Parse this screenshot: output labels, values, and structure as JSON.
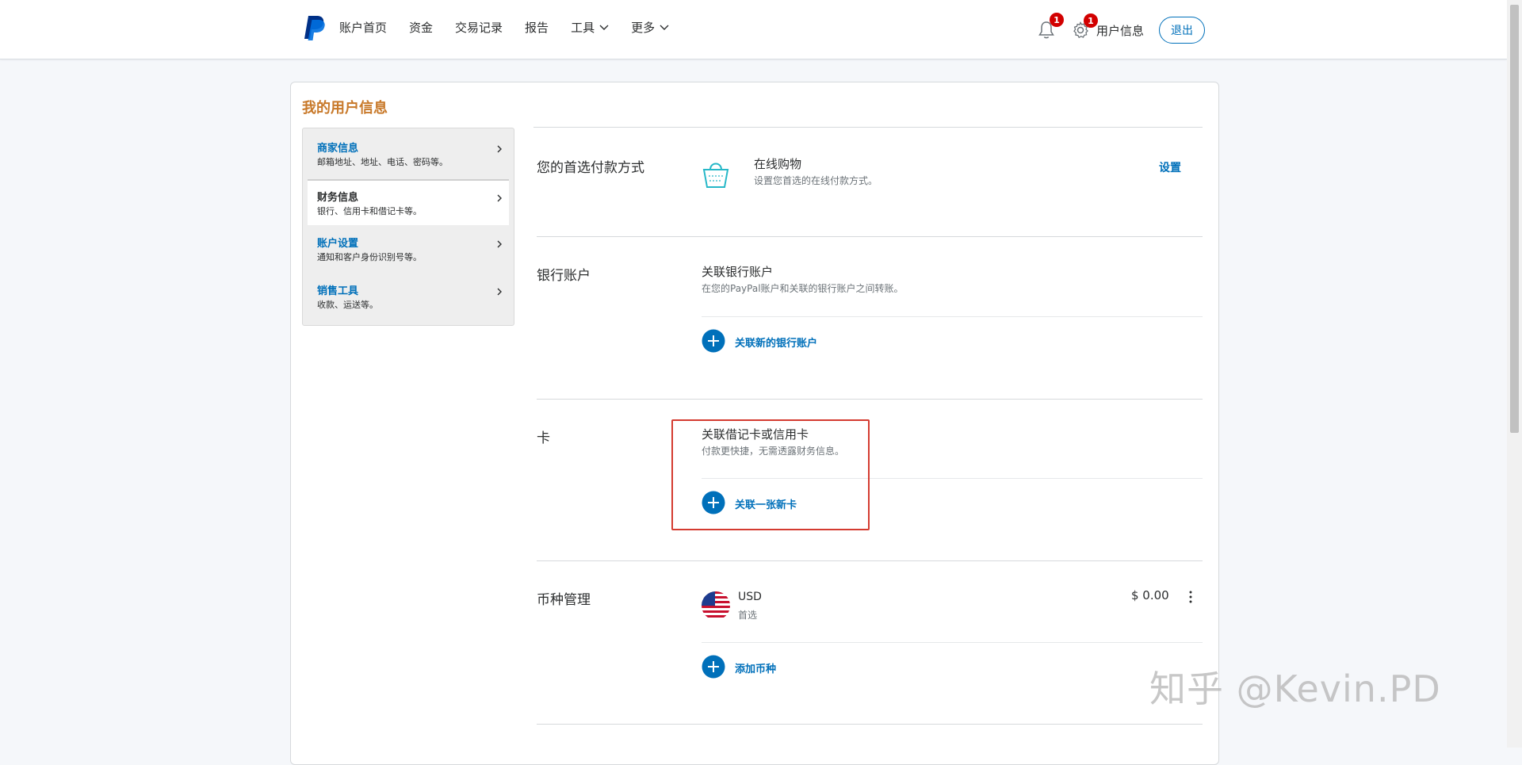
{
  "header": {
    "nav": [
      "账户首页",
      "资金",
      "交易记录",
      "报告",
      "工具",
      "更多"
    ],
    "notifications_count": "1",
    "settings_count": "1",
    "user_info_label": "用户信息",
    "logout_label": "退出"
  },
  "colors": {
    "brand_blue": "#0070ba",
    "title_orange": "#c8792a",
    "badge_red": "#d20000",
    "highlight_red": "#d43b30"
  },
  "page": {
    "title": "我的用户信息"
  },
  "sidebar": {
    "items": [
      {
        "title": "商家信息",
        "desc": "邮箱地址、地址、电话、密码等。"
      },
      {
        "title": "财务信息",
        "desc": "银行、信用卡和借记卡等。"
      },
      {
        "title": "账户设置",
        "desc": "通知和客户身份识别号等。"
      },
      {
        "title": "销售工具",
        "desc": "收款、运送等。"
      }
    ]
  },
  "sections": {
    "preferred": {
      "label": "您的首选付款方式",
      "title": "在线购物",
      "sub": "设置您首选的在线付款方式。",
      "action": "设置",
      "icon": "shopping-basket-icon"
    },
    "bank": {
      "label": "银行账户",
      "title": "关联银行账户",
      "sub": "在您的PayPal账户和关联的银行账户之间转账。",
      "link": "关联新的银行账户"
    },
    "cards": {
      "label": "卡",
      "title": "关联借记卡或信用卡",
      "sub": "付款更快捷，无需透露财务信息。",
      "link": "关联一张新卡"
    },
    "currency": {
      "label": "币种管理",
      "code": "USD",
      "tag": "首选",
      "amount": "$ 0.00",
      "link": "添加币种",
      "icon": "us-flag-icon"
    }
  },
  "watermark": "知乎 @Kevin.PD"
}
